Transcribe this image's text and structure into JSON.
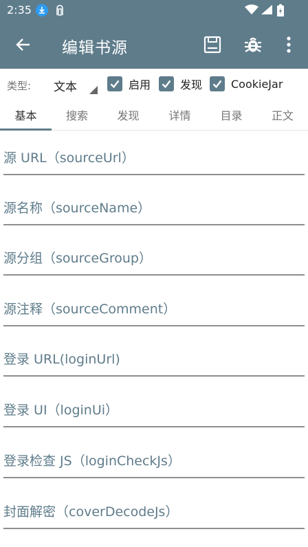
{
  "statusbar": {
    "time": "2:35"
  },
  "appbar": {
    "title": "编辑书源"
  },
  "typebar": {
    "label": "类型:",
    "selected_type": "文本",
    "checkboxes": [
      {
        "label": "启用",
        "checked": true
      },
      {
        "label": "发现",
        "checked": true
      },
      {
        "label": "CookieJar",
        "checked": true
      }
    ]
  },
  "tabs": [
    {
      "label": "基本",
      "active": true
    },
    {
      "label": "搜索"
    },
    {
      "label": "发现"
    },
    {
      "label": "详情"
    },
    {
      "label": "目录"
    },
    {
      "label": "正文"
    }
  ],
  "fields": [
    {
      "hint": "源 URL（sourceUrl）"
    },
    {
      "hint": "源名称（sourceName）"
    },
    {
      "hint": "源分组（sourceGroup）"
    },
    {
      "hint": "源注释（sourceComment）"
    },
    {
      "hint": "登录 URL(loginUrl)"
    },
    {
      "hint": "登录 UI（loginUi）"
    },
    {
      "hint": "登录检查 JS（loginCheckJs）"
    },
    {
      "hint": "封面解密（coverDecodeJs）"
    }
  ],
  "colors": {
    "primary": "#5f7c8b",
    "hint_text": "#5f7c8b",
    "underline": "#8e8e8e"
  },
  "icons": [
    "download-icon",
    "nfc-icon",
    "wifi-icon",
    "signal-icon",
    "battery-icon",
    "back-arrow-icon",
    "save-icon",
    "bug-icon",
    "more-vert-icon",
    "check-icon",
    "dropdown-arrow-icon"
  ]
}
